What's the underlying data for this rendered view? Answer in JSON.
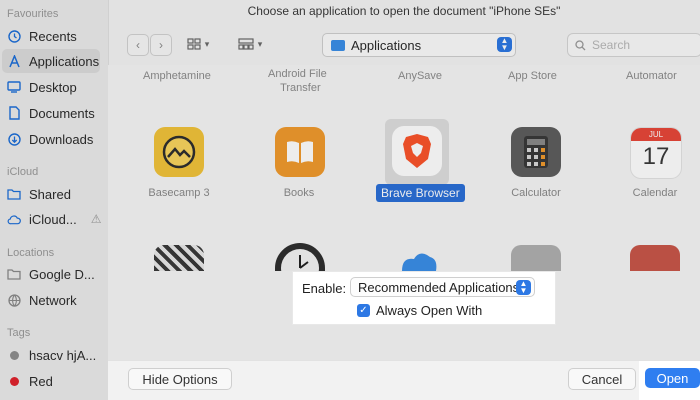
{
  "dialog": {
    "title": "Choose an application to open the document \"iPhone SEs\"",
    "location": "Applications",
    "search_placeholder": "Search"
  },
  "sidebar": {
    "sections": [
      "Favourites",
      "iCloud",
      "Locations",
      "Tags"
    ],
    "favourites": [
      {
        "label": "Recents",
        "icon": "clock-icon"
      },
      {
        "label": "Applications",
        "icon": "applications-icon",
        "selected": true
      },
      {
        "label": "Desktop",
        "icon": "desktop-icon"
      },
      {
        "label": "Documents",
        "icon": "document-icon"
      },
      {
        "label": "Downloads",
        "icon": "download-icon"
      }
    ],
    "icloud": [
      {
        "label": "Shared",
        "icon": "shared-folder-icon"
      },
      {
        "label": "iCloud...",
        "icon": "cloud-icon",
        "warning": "⚠"
      }
    ],
    "locations": [
      {
        "label": "Google D...",
        "icon": "drive-icon"
      },
      {
        "label": "Network",
        "icon": "globe-icon"
      }
    ],
    "tags": [
      {
        "label": "hsacv hjA...",
        "color": "#8f8f8f"
      },
      {
        "label": "Red",
        "color": "#e0242e"
      }
    ]
  },
  "grid": {
    "top_row": [
      "Amphetamine",
      "Android File",
      "Transfer",
      "AnySave",
      "App Store",
      "Automator"
    ],
    "apps": [
      {
        "label": "Basecamp 3",
        "color": "#f2c33b"
      },
      {
        "label": "Books",
        "color": "#f09a2e"
      },
      {
        "label": "Brave Browser",
        "color": "#fb542b",
        "selected": true
      },
      {
        "label": "Calculator",
        "color": "#5e5e5e"
      },
      {
        "label": "Calendar",
        "color": "#ffffff",
        "day": "17",
        "month": "JUL"
      }
    ]
  },
  "options": {
    "enable_label": "Enable:",
    "enable_value": "Recommended Applications",
    "always_open_label": "Always Open With",
    "always_open_checked": true
  },
  "buttons": {
    "hide_options": "Hide Options",
    "cancel": "Cancel",
    "open": "Open"
  },
  "colors": {
    "accent": "#2f7ef0",
    "sidebar_icon": "#1e6fd9"
  }
}
